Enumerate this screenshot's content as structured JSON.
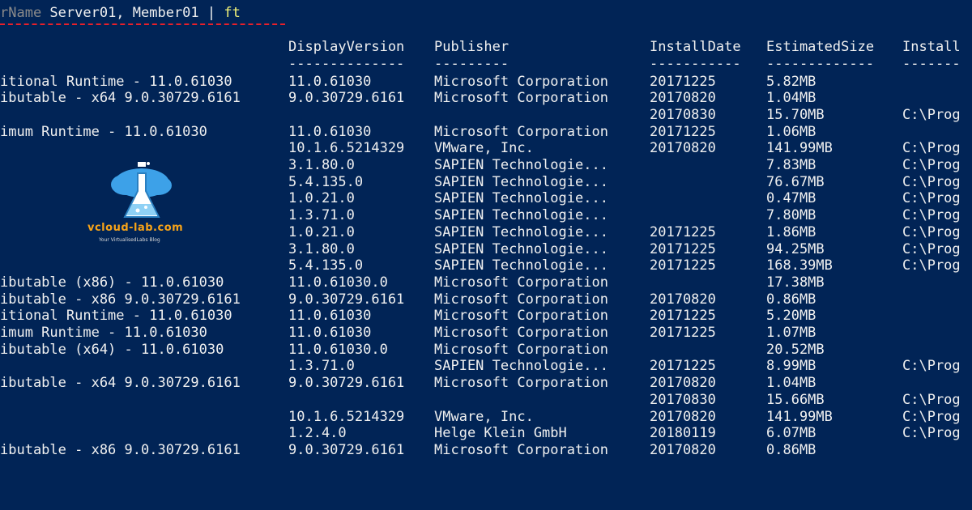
{
  "command": {
    "param_fragment": "rName",
    "args": " Server01, Member01 ",
    "pipe": "| ",
    "format_cmd": "ft"
  },
  "table": {
    "headers": [
      "",
      "DisplayVersion",
      "Publisher",
      "InstallDate",
      "EstimatedSize",
      "Install"
    ],
    "separators": [
      "",
      "--------------",
      "---------",
      "-----------",
      "-------------",
      "-------"
    ],
    "rows": [
      [
        "itional Runtime - 11.0.61030",
        "11.0.61030",
        "Microsoft Corporation",
        "20171225",
        "5.82MB",
        ""
      ],
      [
        "ibutable - x64 9.0.30729.6161",
        "9.0.30729.6161",
        "Microsoft Corporation",
        "20170820",
        "1.04MB",
        ""
      ],
      [
        "",
        "",
        "",
        "20170830",
        "15.70MB",
        "C:\\Prog"
      ],
      [
        "imum Runtime - 11.0.61030",
        "11.0.61030",
        "Microsoft Corporation",
        "20171225",
        "1.06MB",
        ""
      ],
      [
        "",
        "10.1.6.5214329",
        "VMware, Inc.",
        "20170820",
        "141.99MB",
        "C:\\Prog"
      ],
      [
        "",
        "3.1.80.0",
        "SAPIEN Technologie...",
        "",
        "7.83MB",
        "C:\\Prog"
      ],
      [
        "",
        "5.4.135.0",
        "SAPIEN Technologie...",
        "",
        "76.67MB",
        "C:\\Prog"
      ],
      [
        "",
        "1.0.21.0",
        "SAPIEN Technologie...",
        "",
        "0.47MB",
        "C:\\Prog"
      ],
      [
        "",
        "1.3.71.0",
        "SAPIEN Technologie...",
        "",
        "7.80MB",
        "C:\\Prog"
      ],
      [
        "",
        "1.0.21.0",
        "SAPIEN Technologie...",
        "20171225",
        "1.86MB",
        "C:\\Prog"
      ],
      [
        "",
        "3.1.80.0",
        "SAPIEN Technologie...",
        "20171225",
        "94.25MB",
        "C:\\Prog"
      ],
      [
        "",
        "5.4.135.0",
        "SAPIEN Technologie...",
        "20171225",
        "168.39MB",
        "C:\\Prog"
      ],
      [
        "ibutable (x86) - 11.0.61030",
        "11.0.61030.0",
        "Microsoft Corporation",
        "",
        "17.38MB",
        ""
      ],
      [
        "ibutable - x86 9.0.30729.6161",
        "9.0.30729.6161",
        "Microsoft Corporation",
        "20170820",
        "0.86MB",
        ""
      ],
      [
        "itional Runtime - 11.0.61030",
        "11.0.61030",
        "Microsoft Corporation",
        "20171225",
        "5.20MB",
        ""
      ],
      [
        "imum Runtime - 11.0.61030",
        "11.0.61030",
        "Microsoft Corporation",
        "20171225",
        "1.07MB",
        ""
      ],
      [
        "ibutable (x64) - 11.0.61030",
        "11.0.61030.0",
        "Microsoft Corporation",
        "",
        "20.52MB",
        ""
      ],
      [
        "",
        "1.3.71.0",
        "SAPIEN Technologie...",
        "20171225",
        "8.99MB",
        "C:\\Prog"
      ],
      [
        "ibutable - x64 9.0.30729.6161",
        "9.0.30729.6161",
        "Microsoft Corporation",
        "20170820",
        "1.04MB",
        ""
      ],
      [
        "",
        "",
        "",
        "20170830",
        "15.66MB",
        "C:\\Prog"
      ],
      [
        "",
        "10.1.6.5214329",
        "VMware, Inc.",
        "20170820",
        "141.99MB",
        "C:\\Prog"
      ],
      [
        "",
        "1.2.4.0",
        "Helge Klein GmbH",
        "20180119",
        "6.07MB",
        "C:\\Prog"
      ],
      [
        "ibutable - x86 9.0.30729.6161",
        "9.0.30729.6161",
        "Microsoft Corporation",
        "20170820",
        "0.86MB",
        ""
      ]
    ]
  },
  "watermark": {
    "name": "vcloud-lab.com",
    "tagline": "Your VirtualisedLabs Blog"
  },
  "colors": {
    "background": "#012456",
    "text": "#f0f0f0",
    "parameter": "#8a8a8a",
    "highlight": "#f4f478",
    "underline": "#e8202a",
    "logo_cloud": "#3da1e8",
    "logo_text": "#f7a318"
  }
}
